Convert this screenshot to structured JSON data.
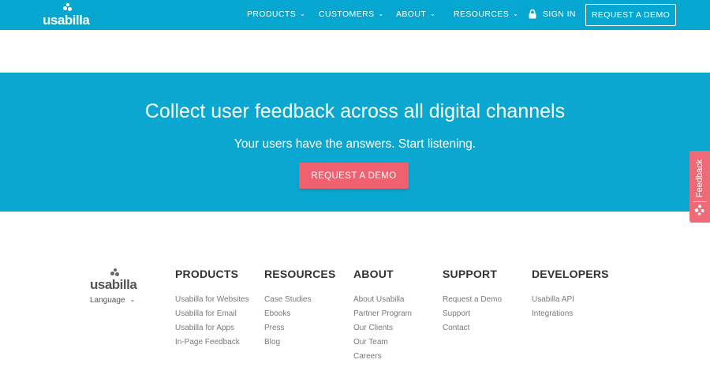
{
  "nav": {
    "logo": "usabilla",
    "items": [
      {
        "label": "PRODUCTS"
      },
      {
        "label": "CUSTOMERS"
      },
      {
        "label": "ABOUT"
      },
      {
        "label": "RESOURCES"
      }
    ],
    "sign_in": "SIGN IN",
    "demo_label": "REQUEST A DEMO",
    "chevron_icon": "chevron-down-icon",
    "lock_icon": "lock-icon"
  },
  "hero": {
    "title": "Collect user feedback across all digital channels",
    "subtitle": "Your users have the answers. Start listening.",
    "cta_label": "REQUEST A DEMO"
  },
  "feedback_tab": {
    "label": "Feedback",
    "icon": "usabilla-dots-icon"
  },
  "footer": {
    "logo": "usabilla",
    "language": "Language",
    "columns": [
      {
        "title": "PRODUCTS",
        "links": [
          "Usabilla for Websites",
          "Usabilla for Email",
          "Usabilla for Apps",
          "In-Page Feedback"
        ]
      },
      {
        "title": "RESOURCES",
        "links": [
          "Case Studies",
          "Ebooks",
          "Press",
          "Blog"
        ]
      },
      {
        "title": "ABOUT",
        "links": [
          "About Usabilla",
          "Partner Program",
          "Our Clients",
          "Our Team",
          "Careers"
        ]
      },
      {
        "title": "SUPPORT",
        "links": [
          "Request a Demo",
          "Support",
          "Contact"
        ]
      },
      {
        "title": "DEVELOPERS",
        "links": [
          "Usabilla API",
          "Integrations"
        ]
      }
    ]
  },
  "colors": {
    "brand_blue": "#05a6cf",
    "hero_blue": "#0aa7d1",
    "cta_coral": "#f0616f",
    "feedback_pink": "#ee6a77"
  }
}
